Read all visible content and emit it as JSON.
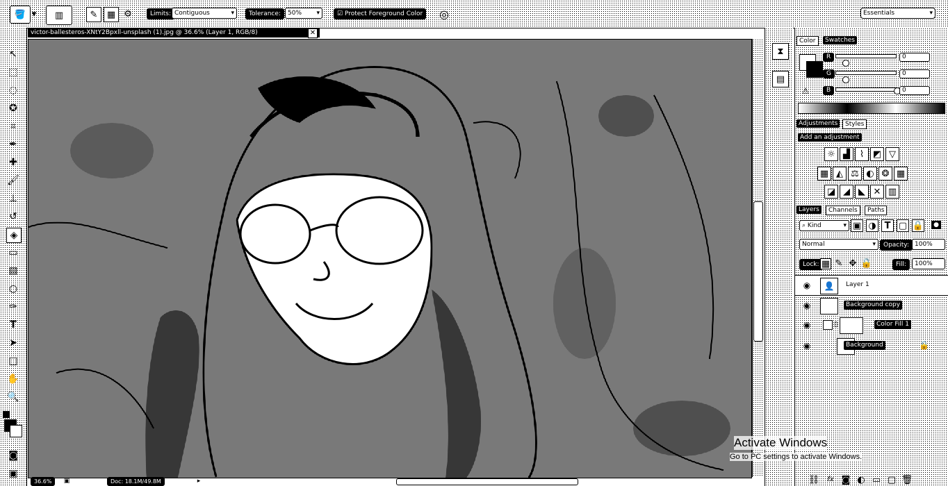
{
  "options_bar": {
    "limits_label": "Limits:",
    "limits_value": "Contiguous",
    "tolerance_label": "Tolerance:",
    "tolerance_value": "50%",
    "protect_fg_label": "Protect Foreground Color",
    "protect_fg_checked": true,
    "workspace": "Essentials"
  },
  "document": {
    "tab_title": "victor-ballesteros-XNtY2Bpxll-unsplash (1).jpg @ 36.6% (Layer 1, RGB/8)",
    "zoom": "36.6%",
    "doc_size": "Doc: 18.1M/49.8M"
  },
  "color_panel": {
    "tabs": [
      "Color",
      "Swatches"
    ],
    "channels": [
      {
        "label": "R",
        "value": "0"
      },
      {
        "label": "G",
        "value": "0"
      },
      {
        "label": "B",
        "value": "0"
      }
    ]
  },
  "adjustments_panel": {
    "tabs": [
      "Adjustments",
      "Styles"
    ],
    "heading": "Add an adjustment",
    "icon_rows": [
      [
        "brightness-icon",
        "levels-icon",
        "curves-icon",
        "exposure-icon",
        "triangle-icon"
      ],
      [
        "vibrance-icon",
        "hue-icon",
        "colorbalance-icon",
        "bw-icon",
        "photofilter-icon",
        "channelmixer-icon"
      ],
      [
        "invert-icon",
        "posterize-icon",
        "threshold-icon",
        "gradientmap-icon",
        "selectivecolor-icon"
      ]
    ]
  },
  "layers_panel": {
    "tabs": [
      "Layers",
      "Channels",
      "Paths"
    ],
    "kind_filter": "Kind",
    "blend_mode": "Normal",
    "opacity_label": "Opacity:",
    "opacity_value": "100%",
    "lock_label": "Lock:",
    "fill_label": "Fill:",
    "fill_value": "100%",
    "layers": [
      {
        "name": "Layer 1",
        "selected": true
      },
      {
        "name": "Background copy",
        "selected": false
      },
      {
        "name": "Color Fill 1",
        "selected": false
      },
      {
        "name": "Background",
        "selected": false,
        "locked": true
      }
    ]
  },
  "watermark": {
    "title": "Activate Windows",
    "subtitle": "Go to PC settings to activate Windows."
  }
}
